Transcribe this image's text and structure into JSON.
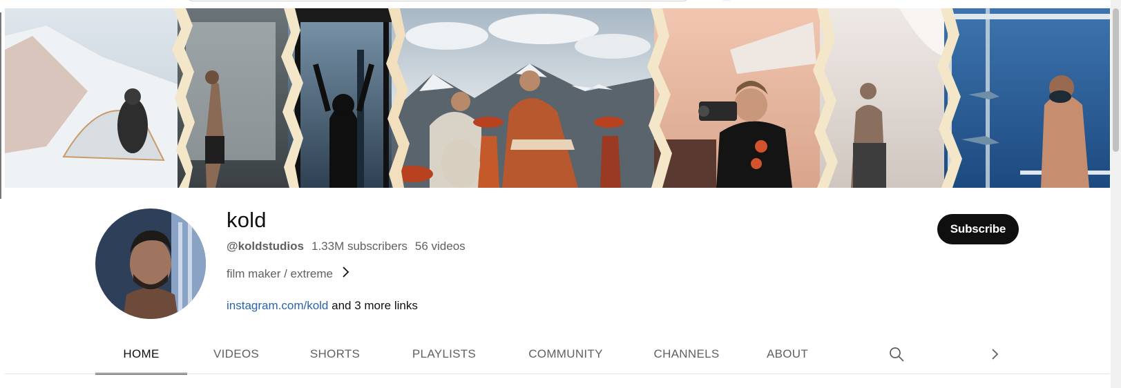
{
  "channel": {
    "name": "kold",
    "handle": "@koldstudios",
    "subscribers": "1.33M subscribers",
    "videos": "56 videos",
    "description": "film maker / extreme",
    "link_text": "instagram.com/kold",
    "more_links": "and 3 more links",
    "subscribe_label": "Subscribe"
  },
  "tabs": [
    {
      "label": "HOME",
      "active": true
    },
    {
      "label": "VIDEOS",
      "active": false
    },
    {
      "label": "SHORTS",
      "active": false
    },
    {
      "label": "PLAYLISTS",
      "active": false
    },
    {
      "label": "COMMUNITY",
      "active": false
    },
    {
      "label": "CHANNELS",
      "active": false
    },
    {
      "label": "ABOUT",
      "active": false
    }
  ],
  "icons": {
    "tab_search": "search-icon",
    "tab_next": "chevron-right-icon",
    "description_more": "chevron-right-icon"
  },
  "colors": {
    "subscribe_bg": "#0f0f0f",
    "link": "#2a63a8",
    "muted_text": "#606060"
  }
}
